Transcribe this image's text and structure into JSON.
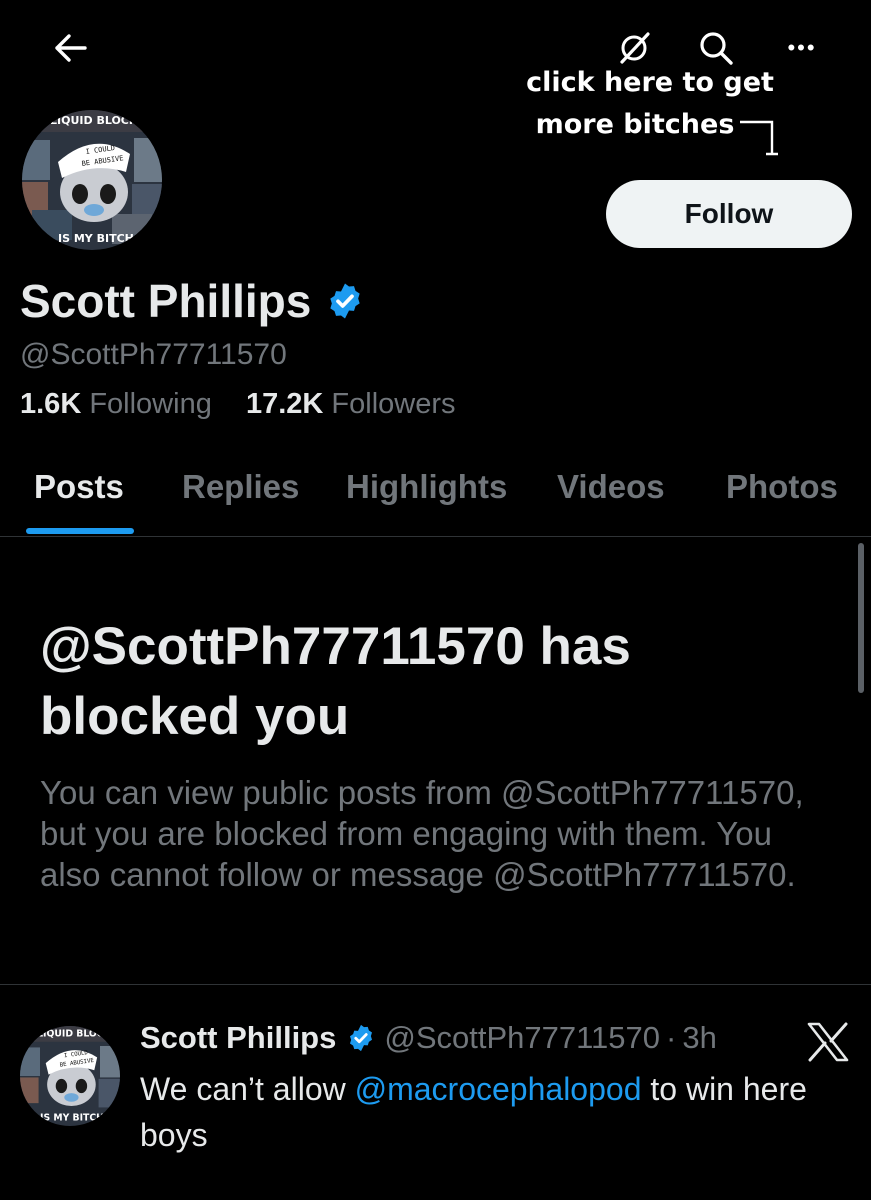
{
  "header": {
    "icons": [
      "back-arrow-icon",
      "grok-icon",
      "search-icon",
      "more-icon"
    ],
    "more_glyph": "•••"
  },
  "caption": {
    "line1": "click here to get",
    "line2": "more bitches"
  },
  "avatar": {
    "top_text": "LIQUID BLOCK",
    "hat_line1": "I COULD",
    "hat_line2": "BE ABUSIVE",
    "bottom_text": "IS MY BITCH"
  },
  "profile": {
    "follow_label": "Follow",
    "display_name": "Scott Phillips",
    "handle": "@ScottPh77711570",
    "following_count": "1.6K",
    "following_label": "Following",
    "followers_count": "17.2K",
    "followers_label": "Followers"
  },
  "tabs": [
    {
      "label": "Posts",
      "active": true
    },
    {
      "label": "Replies",
      "active": false
    },
    {
      "label": "Highlights",
      "active": false
    },
    {
      "label": "Videos",
      "active": false
    },
    {
      "label": "Photos",
      "active": false
    }
  ],
  "blocked": {
    "title": "@ScottPh77711570 has blocked you",
    "body": "You can view public posts from @ScottPh77711570, but you are blocked from engaging with them. You also cannot follow or message @ScottPh77711570."
  },
  "tweet": {
    "name": "Scott Phillips",
    "handle": "@ScottPh77711570",
    "dot": "·",
    "time": "3h",
    "text_before": "We can’t allow ",
    "mention": "@macrocephalopod",
    "text_after": " to win here boys"
  },
  "colors": {
    "background": "#000000",
    "text_primary": "#e7e9ea",
    "text_secondary": "#71767b",
    "accent": "#1d9bf0",
    "follow_button_bg": "#eff3f4",
    "border": "#2f3336"
  }
}
